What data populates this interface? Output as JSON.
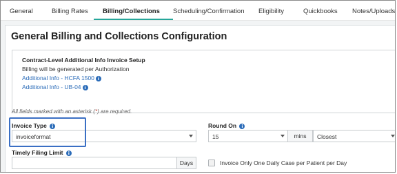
{
  "tabs": [
    {
      "label": "General"
    },
    {
      "label": "Billing Rates"
    },
    {
      "label": "Billing/Collections"
    },
    {
      "label": "Scheduling/Confirmation"
    },
    {
      "label": "Eligibility"
    },
    {
      "label": "Quickbooks"
    },
    {
      "label": "Notes/Uploads"
    }
  ],
  "active_tab": "Billing/Collections",
  "accent_color": "#26a69a",
  "link_color": "#2a6bb8",
  "page_title": "General Billing and Collections Configuration",
  "info_box": {
    "title": "Contract-Level Additional Info Invoice Setup",
    "line": "Billing will be generated per Authorization",
    "links": [
      {
        "label": "Additional Info - HCFA 1500",
        "icon": "info-icon"
      },
      {
        "label": "Additional Info - UB-04",
        "icon": "info-icon"
      }
    ]
  },
  "required_note": {
    "before": "All fields marked with an asterisk (",
    "asterisk": "*",
    "after": ") are required."
  },
  "invoice_type": {
    "label": "Invoice Type",
    "value": "invoiceformat"
  },
  "round_on": {
    "label": "Round On",
    "amount": "15",
    "unit": "mins",
    "method": "Closest"
  },
  "timely_filing": {
    "label": "Timely Filing Limit",
    "value": "",
    "unit": "Days"
  },
  "daily_case_checkbox": {
    "label": "Invoice Only One Daily Case per Patient per Day",
    "checked": false
  }
}
